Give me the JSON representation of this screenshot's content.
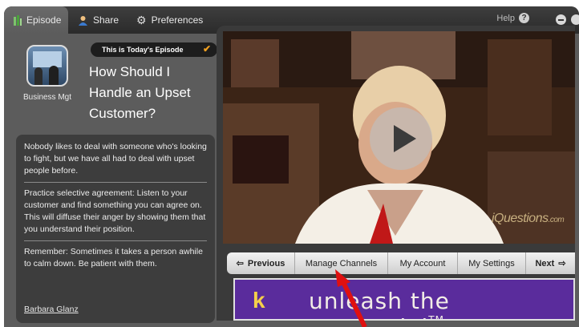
{
  "tabs": [
    {
      "label": "Episode",
      "icon": "episode-icon"
    },
    {
      "label": "Share",
      "icon": "share-person-icon"
    },
    {
      "label": "Preferences",
      "icon": "gear-icon"
    }
  ],
  "help": {
    "label": "Help"
  },
  "episode": {
    "badge": "This is Today's Episode",
    "category": "Business Mgt",
    "title": "How Should I Handle an Upset Customer?",
    "paragraphs": [
      "Nobody likes to deal with someone who's looking to fight, but we have all had to deal with upset people before.",
      "Practice selective agreement: Listen to your customer and find something you can agree on. This will diffuse their anger by showing them that you understand their position.",
      "Remember: Sometimes it takes a person awhile to calm down. Be patient with them."
    ],
    "author": "Barbara Glanz"
  },
  "video": {
    "watermark": "iQuestions",
    "watermark_suffix": ".com"
  },
  "nav": {
    "previous": "Previous",
    "manage_channels": "Manage Channels",
    "my_account": "My Account",
    "my_settings": "My Settings",
    "next": "Next"
  },
  "banner": {
    "part1": "unleash the ",
    "x": "x",
    "part2": "Potential",
    "tm": "TM"
  },
  "colors": {
    "accent": "#f0a020",
    "banner_bg": "#5a2c9c",
    "arrow": "#e01010"
  }
}
